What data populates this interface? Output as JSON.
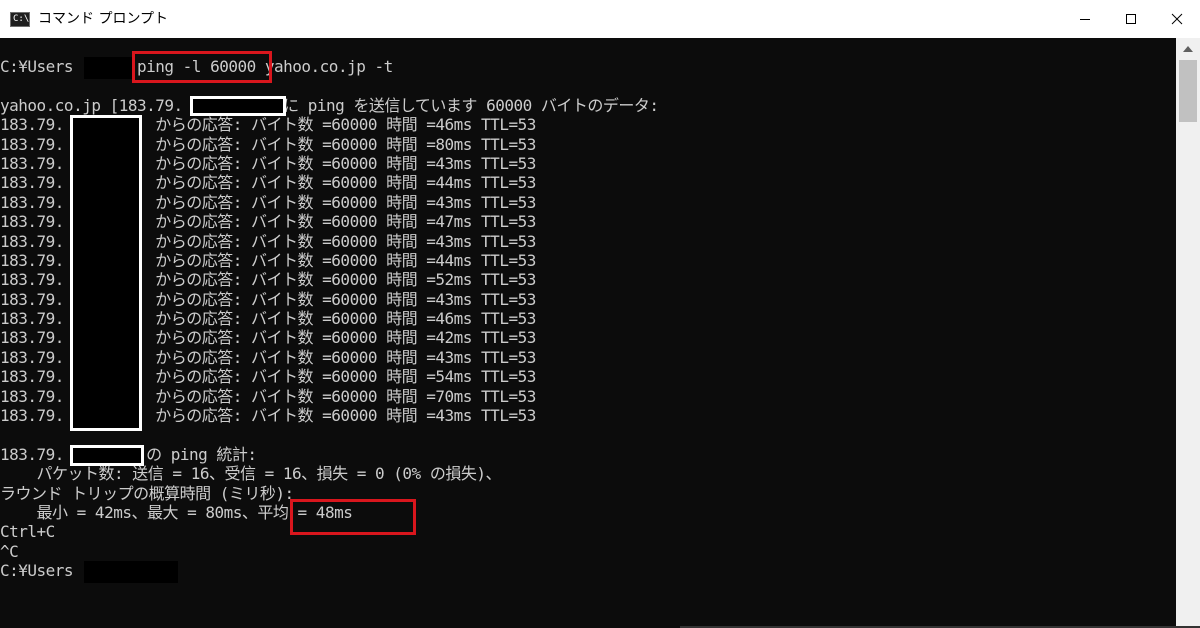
{
  "window": {
    "title": "コマンド プロンプト",
    "app_icon_text": "C:\\.",
    "controls": [
      "minimize",
      "maximize",
      "close"
    ]
  },
  "terminal": {
    "command_line": {
      "prompt": "C:¥Users",
      "highlighted": "ping -l 60000",
      "rest": "yahoo.co.jp -t"
    },
    "header_line": "yahoo.co.jp [183.79.         ] に ping を送信しています 60000 バイトのデータ:",
    "reply_prefix": "183.79.",
    "reply_label": "からの応答: バイト数 =60000 時間 =",
    "ttl_label": "TTL=53",
    "replies": [
      "46ms",
      "80ms",
      "43ms",
      "44ms",
      "43ms",
      "47ms",
      "43ms",
      "44ms",
      "52ms",
      "43ms",
      "46ms",
      "42ms",
      "43ms",
      "54ms",
      "70ms",
      "43ms"
    ],
    "stats_header": "183.79.         の ping 統計:",
    "packets_line": "    パケット数: 送信 = 16、受信 = 16、損失 = 0 (0% の損失)、",
    "rtt_header": "ラウンド トリップの概算時間 (ミリ秒):",
    "rtt_line_prefix": "    最小 = 42ms、最大 = 80ms、",
    "rtt_average": "平均 = 48ms",
    "ctrl_c": "Ctrl+C",
    "caret_c": "^C",
    "final_prompt": "C:¥Users"
  },
  "highlight_color": "#d9161d"
}
